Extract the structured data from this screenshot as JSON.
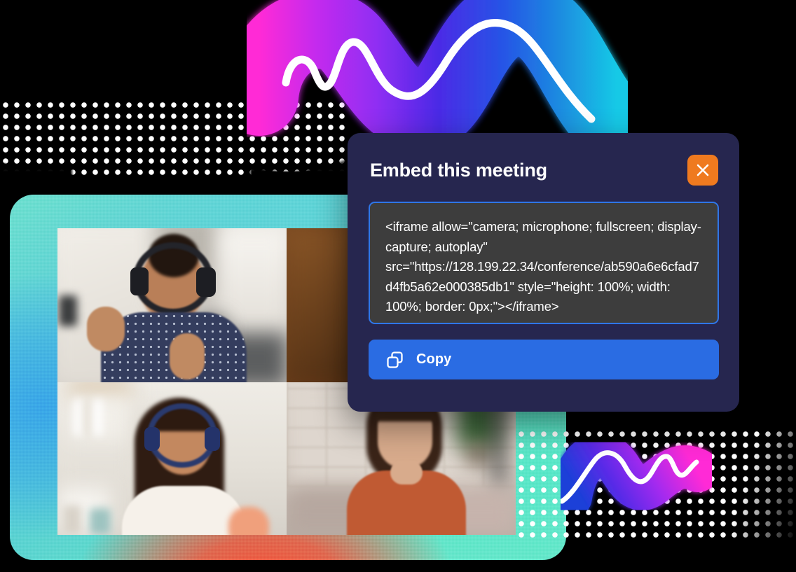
{
  "modal": {
    "title": "Embed this meeting",
    "close_icon": "close-x-icon",
    "embed_code": "<iframe allow=\"camera; microphone; fullscreen; display-capture; autoplay\" src=\"https://128.199.22.34/conference/ab590a6e6cfad7d4fb5a62e000385db1\" style=\"height: 100%; width: 100%; border: 0px;\"></iframe>",
    "copy_button_label": "Copy",
    "copy_icon": "copy-duplicate-icon",
    "colors": {
      "surface": "#26264f",
      "close": "#ef7a1f",
      "primary": "#2a6ce3",
      "code_bg": "#3d3d3d",
      "code_border": "#2f76e8"
    }
  },
  "meeting": {
    "card_label": "video-call-card",
    "participants": [
      {
        "name": "participant-1",
        "description": "Woman with headset waving in a kitchen"
      },
      {
        "name": "participant-2",
        "description": "Participant in front of a wood wall"
      },
      {
        "name": "participant-3",
        "description": "Woman with curly hair and headphones at a desk"
      },
      {
        "name": "participant-4",
        "description": "Woman in a rust top by a brick wall"
      }
    ]
  },
  "decor": {
    "wave_top": "gradient-sound-wave",
    "wave_bottom": "gradient-sound-wave-small",
    "dots_top": "halftone-dot-band",
    "dots_bottom": "halftone-dot-block",
    "gradient_stops": [
      "#ff2bd6",
      "#9b2df0",
      "#3b2ce0",
      "#1d6fe8",
      "#19c6e8"
    ]
  }
}
